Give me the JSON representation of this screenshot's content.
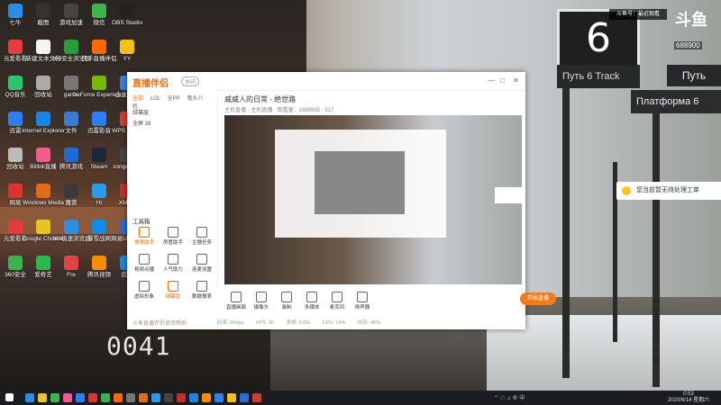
{
  "desktop_icons": [
    {
      "label": "七牛",
      "color": "#2a8ee8"
    },
    {
      "label": "元爱看看",
      "color": "#e43c3c"
    },
    {
      "label": "QQ音乐",
      "color": "#2cc46c"
    },
    {
      "label": "迅雷",
      "color": "#2f7cf6"
    },
    {
      "label": "回收站",
      "color": "#bbbbbb"
    },
    {
      "label": "网易",
      "color": "#d33"
    },
    {
      "label": "元爱看看",
      "color": "#e43c3c"
    },
    {
      "label": "360安全",
      "color": "#3bb24a"
    },
    {
      "label": "截图",
      "color": "#333"
    },
    {
      "label": "新建文本文档",
      "color": "#f5f5f5"
    },
    {
      "label": "回收站",
      "color": "#aaaaaa"
    },
    {
      "label": "Internet Explorer",
      "color": "#1b84e6"
    },
    {
      "label": "Bilibili直播",
      "color": "#f15b8f"
    },
    {
      "label": "Windows Media",
      "color": "#e06b18"
    },
    {
      "label": "Google Chrome",
      "color": "#e8c420"
    },
    {
      "label": "爱奇艺",
      "color": "#2db84d"
    },
    {
      "label": "游戏加速",
      "color": "#444"
    },
    {
      "label": "360安全浏览器",
      "color": "#2a9b3b"
    },
    {
      "label": "game",
      "color": "#777"
    },
    {
      "label": "文件",
      "color": "#3b7bd6"
    },
    {
      "label": "腾讯游戏",
      "color": "#1e6bd6"
    },
    {
      "label": "魔兽",
      "color": "#3a3a3a"
    },
    {
      "label": "360极速浏览器",
      "color": "#2f8ee0"
    },
    {
      "label": "Fre",
      "color": "#d44"
    },
    {
      "label": "微信",
      "color": "#3cb54a"
    },
    {
      "label": "快手直播伴侣",
      "color": "#ff6a00"
    },
    {
      "label": "GeForce Experience",
      "color": "#76b900"
    },
    {
      "label": "迅雷影音",
      "color": "#2f7cf6"
    },
    {
      "label": "Steam",
      "color": "#1b2838"
    },
    {
      "label": "Hi",
      "color": "#2a9be8"
    },
    {
      "label": "暴雪战网",
      "color": "#0e8de8"
    },
    {
      "label": "腾讯视频",
      "color": "#ff8c00"
    },
    {
      "label": "OBS Studio",
      "color": "#222"
    },
    {
      "label": "YY",
      "color": "#f6c117"
    },
    {
      "label": "企业微信",
      "color": "#3480e8"
    },
    {
      "label": "WPS Office",
      "color": "#d53b2f"
    },
    {
      "label": "zongo_yue",
      "color": "#444"
    },
    {
      "label": "XMind",
      "color": "#c22e2e"
    },
    {
      "label": "网易UU加速",
      "color": "#2b6cd8"
    },
    {
      "label": "应用",
      "color": "#1b84e6"
    }
  ],
  "streamer": {
    "app_logo": "直播伴侣",
    "badge": "水印",
    "tabs": [
      "全部",
      "LOL",
      "全PP",
      "鬼头八机"
    ],
    "scenes": [
      {
        "label": "绿幕层"
      },
      {
        "label": "全屏 28"
      }
    ],
    "room_title": "威威人的日常 - 绝世路",
    "room_sub": "主机直播 · 主机直播 · 观看量：1689955 · 517",
    "tools_title": "工具箱",
    "tools": [
      {
        "label": "快哥助手",
        "orange": true
      },
      {
        "label": "房管助手",
        "orange": false
      },
      {
        "label": "主播任务",
        "orange": false
      },
      {
        "label": "视频点播",
        "orange": false
      },
      {
        "label": "人气助力",
        "orange": false
      },
      {
        "label": "连麦设置",
        "orange": false
      },
      {
        "label": "虚拟形象",
        "orange": false
      },
      {
        "label": "绿幕层",
        "orange": true
      },
      {
        "label": "数据报表",
        "orange": false
      }
    ],
    "footer_link": "斗鱼直播伴侣使用帮助",
    "bottom_actions": [
      "直播画面",
      "摄像头",
      "录制",
      "多媒体",
      "麦克风",
      "扬声器"
    ],
    "start_button": "开始直播",
    "status": [
      "码率: 0Kbps",
      "FPS: 30",
      "丢帧: 0.0%",
      "CPU: 14%",
      "内存: 45%"
    ],
    "window_controls": [
      "—",
      "□",
      "✕"
    ]
  },
  "popup": {
    "text": "您当前暂无待处理工单"
  },
  "overlay": {
    "tag": "斗鱼号：最近观看",
    "logo": "斗鱼",
    "sign_number": "6",
    "sign_text": "Путь 6 Track",
    "plat_text": "Платформа 6",
    "put2_text": "Путь",
    "room_id": "688900"
  },
  "train_number": "0041",
  "taskbar": {
    "icons": [
      "#2a8ee8",
      "#e8c420",
      "#3cb54a",
      "#f15b8f",
      "#2f7cf6",
      "#d33",
      "#3bb24a",
      "#ff6a00",
      "#777",
      "#e06b18",
      "#2a9be8",
      "#444",
      "#c22e2e",
      "#1b84e6",
      "#ff8c00",
      "#3480e8",
      "#f6c117",
      "#2b6cd8",
      "#d53b2f"
    ],
    "tray": "⌃ ☁ ♫ ⊕ 中",
    "time": "0:53",
    "date": "2020/6/14 星期六"
  }
}
